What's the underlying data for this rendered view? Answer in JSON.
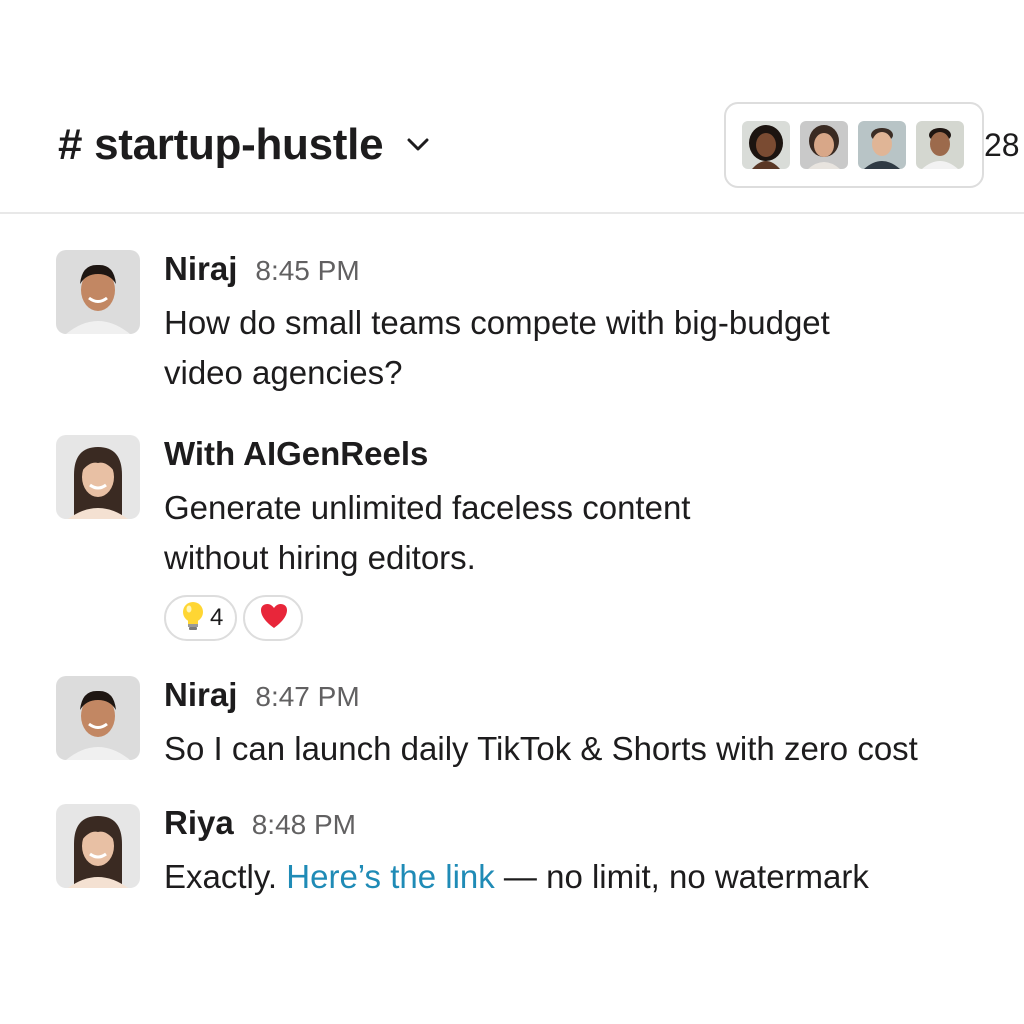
{
  "header": {
    "channel_name": "# startup-hustle",
    "member_count": "28",
    "member_avatar_icons": [
      "member-avatar-1",
      "member-avatar-2",
      "member-avatar-3",
      "member-avatar-4"
    ],
    "chevron_icon": "chevron-down-icon"
  },
  "messages": [
    {
      "sender": "Niraj",
      "time": "8:45 PM",
      "lines": [
        "How do small teams compete with big-budget",
        "video agencies?"
      ]
    },
    {
      "sender": "With AIGenReels",
      "time": "",
      "lines": [
        "Generate unlimited faceless content",
        "without hiring editors."
      ],
      "reactions": [
        {
          "emoji": "lightbulb-icon",
          "count": "4"
        },
        {
          "emoji": "heart-icon",
          "count": ""
        }
      ]
    },
    {
      "sender": "Niraj",
      "time": "8:47 PM",
      "lines": [
        "So I can launch daily TikTok & Shorts with zero cost"
      ]
    },
    {
      "sender": "Riya",
      "time": "8:48 PM",
      "text_before": "Exactly. ",
      "link_text": "Here’s the link",
      "text_after": " — no limit, no watermark"
    }
  ],
  "colors": {
    "link": "#1f8bb6",
    "text": "#1d1c1d",
    "timestamp": "#616061",
    "heart": "#e8263a"
  }
}
